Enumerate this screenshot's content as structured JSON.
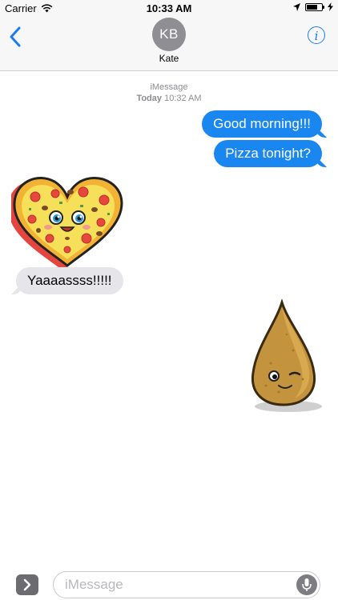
{
  "status_bar": {
    "carrier": "Carrier",
    "time": "10:33 AM",
    "battery_level": 0.7,
    "icons": [
      "wifi-icon",
      "location-arrow-icon",
      "battery-icon",
      "charging-bolt-icon"
    ]
  },
  "nav": {
    "back_icon": "chevron-left-icon",
    "contact_initials": "KB",
    "contact_name": "Kate",
    "info_icon": "info-icon",
    "info_glyph": "i",
    "accent_color": "#1a7cf5"
  },
  "conversation": {
    "service": "iMessage",
    "day": "Today",
    "time": "10:32 AM"
  },
  "messages": [
    {
      "direction": "outgoing",
      "kind": "text",
      "text": "Good morning!!!"
    },
    {
      "direction": "outgoing",
      "kind": "text",
      "text": "Pizza tonight?"
    },
    {
      "direction": "incoming",
      "kind": "sticker",
      "sticker": "pizza-heart-sticker"
    },
    {
      "direction": "incoming",
      "kind": "text",
      "text": "Yaaaassss!!!!!"
    },
    {
      "direction": "outgoing",
      "kind": "sticker",
      "sticker": "winking-coxinha-sticker"
    }
  ],
  "input_bar": {
    "placeholder": "iMessage",
    "apps_icon": "chevron-right-icon",
    "mic_icon": "microphone-icon"
  },
  "colors": {
    "outgoing_bubble": "#1a86f0",
    "incoming_bubble": "#e5e5ea"
  }
}
